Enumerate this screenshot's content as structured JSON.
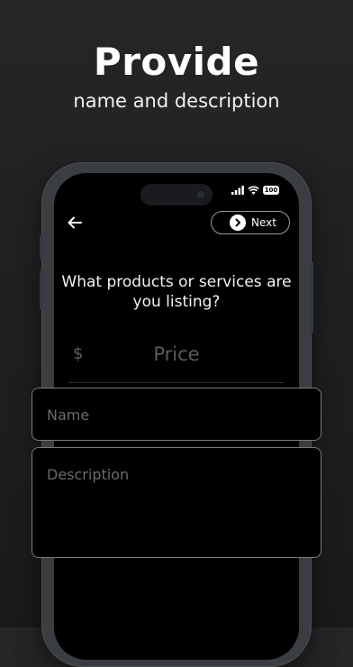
{
  "marketing": {
    "headline": "Provide",
    "subheadline": "name and description"
  },
  "status_bar": {
    "battery_level": "100",
    "icons": [
      "signal-icon",
      "wifi-icon",
      "battery-icon"
    ]
  },
  "nav": {
    "back_icon": "arrow-left-icon",
    "next_label": "Next",
    "next_icon": "chevron-right-icon"
  },
  "form": {
    "question": "What products or services are you listing?",
    "price": {
      "currency_symbol": "$",
      "placeholder": "Price"
    },
    "name": {
      "placeholder": "Name"
    },
    "description": {
      "placeholder": "Description"
    }
  }
}
